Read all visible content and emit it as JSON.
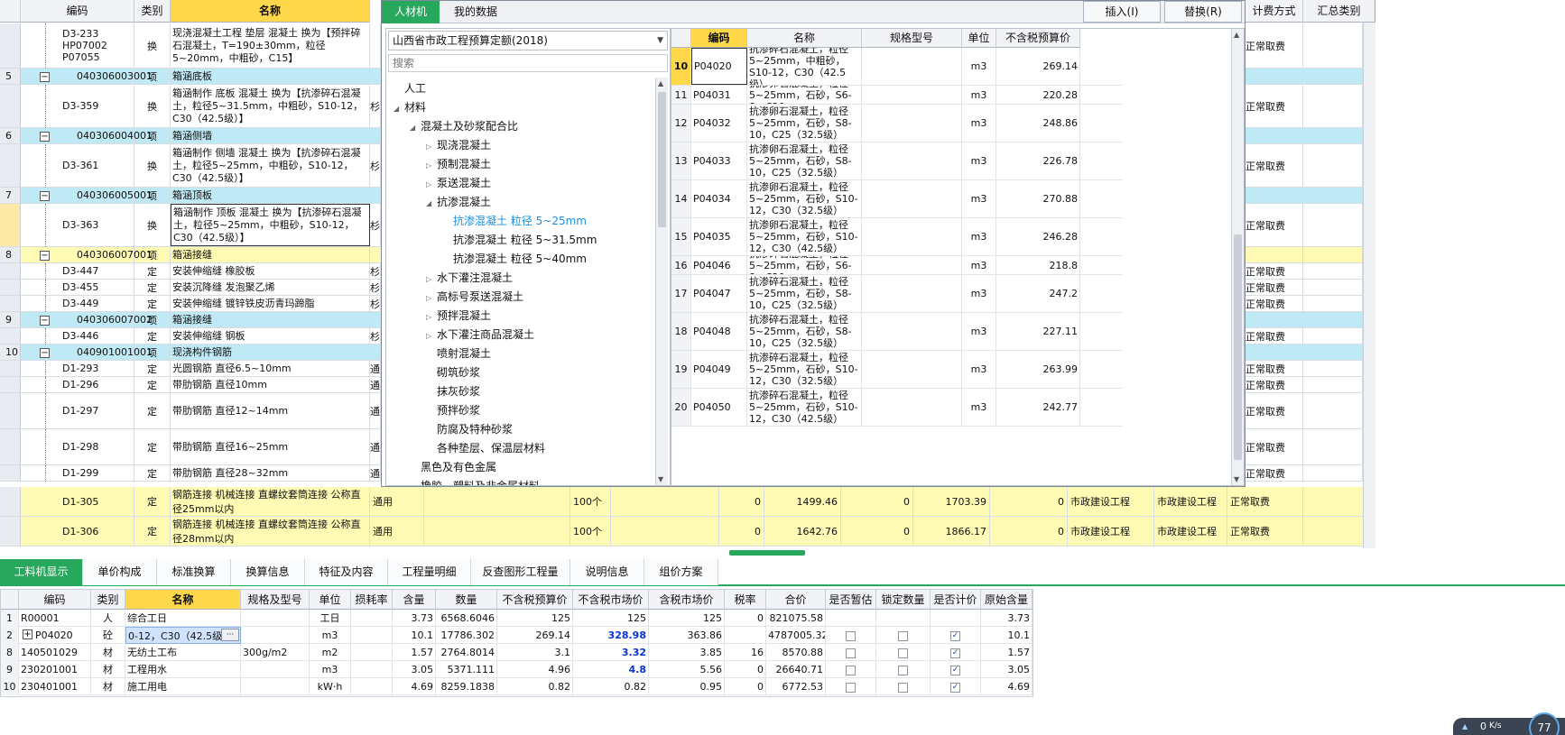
{
  "main_grid": {
    "headers": [
      "编码",
      "类别",
      "名称",
      "计费方式",
      "汇总类别"
    ],
    "rows": [
      {
        "num": "",
        "code": "D3-233\nHP07002\nP07055",
        "type": "换",
        "name": "现浇混凝土工程 垫层 混凝土 换为【预拌碎石混凝土，T=190±30mm，粒径5~20mm，中粗砂，C15】",
        "fee": "正常取费"
      },
      {
        "num": "5",
        "code": "040306003001",
        "type": "项",
        "name": "箱涵底板",
        "fee": ""
      },
      {
        "num": "",
        "code": "D3-359",
        "type": "换",
        "name": "箱涵制作 底板 混凝土 换为【抗渗碎石混凝土，粒径5~31.5mm，中粗砂，S10-12，C30（42.5级）】",
        "fee": "正常取费"
      },
      {
        "num": "6",
        "code": "040306004001",
        "type": "项",
        "name": "箱涵侧墙",
        "fee": ""
      },
      {
        "num": "",
        "code": "D3-361",
        "type": "换",
        "name": "箱涵制作 侧墙 混凝土 换为【抗渗碎石混凝土，粒径5~25mm，中粗砂，S10-12，C30（42.5级）】",
        "fee": "正常取费"
      },
      {
        "num": "7",
        "code": "040306005001",
        "type": "项",
        "name": "箱涵顶板",
        "fee": ""
      },
      {
        "num": "",
        "code": "D3-363",
        "type": "换",
        "name": "箱涵制作 顶板 混凝土 换为【抗渗碎石混凝土，粒径5~25mm，中粗砂，S10-12，C30（42.5级）】",
        "fee": "正常取费"
      },
      {
        "num": "8",
        "code": "040306007001",
        "type": "项",
        "name": "箱涵接缝",
        "fee": ""
      },
      {
        "num": "",
        "code": "D3-447",
        "type": "定",
        "name": "安装伸缩缝 橡胶板",
        "fee": "正常取费"
      },
      {
        "num": "",
        "code": "D3-455",
        "type": "定",
        "name": "安装沉降缝 发泡聚乙烯",
        "fee": "正常取费"
      },
      {
        "num": "",
        "code": "D3-449",
        "type": "定",
        "name": "安装伸缩缝 镀锌铁皮沥青玛蹄脂",
        "fee": "正常取费"
      },
      {
        "num": "9",
        "code": "040306007002",
        "type": "项",
        "name": "箱涵接缝",
        "fee": ""
      },
      {
        "num": "",
        "code": "D3-446",
        "type": "定",
        "name": "安装伸缩缝 钢板",
        "fee": "正常取费"
      },
      {
        "num": "10",
        "code": "040901001001",
        "type": "项",
        "name": "现浇构件钢筋",
        "fee": ""
      },
      {
        "num": "",
        "code": "D1-293",
        "type": "定",
        "name": "光圆钢筋 直径6.5~10mm",
        "fee": "正常取费"
      },
      {
        "num": "",
        "code": "D1-296",
        "type": "定",
        "name": "带肋钢筋 直径10mm",
        "fee": "正常取费"
      },
      {
        "num": "",
        "code": "D1-297",
        "type": "定",
        "name": "带肋钢筋 直径12~14mm",
        "fee": "正常取费"
      },
      {
        "num": "",
        "code": "D1-298",
        "type": "定",
        "name": "带肋钢筋 直径16~25mm",
        "fee": "正常取费"
      },
      {
        "num": "",
        "code": "D1-299",
        "type": "定",
        "name": "带肋钢筋 直径28~32mm",
        "fee": "正常取费"
      }
    ],
    "bottom_rows": [
      {
        "code": "D1-305",
        "type": "定",
        "name": "钢筋连接 机械连接 直螺纹套筒连接 公称直径25mm以内",
        "spec": "通用",
        "unit": "100个",
        "qty": "0",
        "price": "1499.46",
        "v2": "0",
        "v3": "1703.39",
        "v4": "0",
        "c1": "市政建设工程",
        "c2": "市政建设工程",
        "fee": "正常取费"
      },
      {
        "code": "D1-306",
        "type": "定",
        "name": "钢筋连接 机械连接 直螺纹套筒连接 公称直径28mm以内",
        "spec": "通用",
        "unit": "100个",
        "qty": "0",
        "price": "1642.76",
        "v2": "0",
        "v3": "1866.17",
        "v4": "0",
        "c1": "市政建设工程",
        "c2": "市政建设工程",
        "fee": "正常取费"
      }
    ],
    "col_prefix_mid": "杉",
    "col_prefix_end": "通"
  },
  "dialog": {
    "tabs": [
      "人材机",
      "我的数据"
    ],
    "buttons": [
      "插入(I)",
      "替换(R)"
    ],
    "quota_select": "山西省市政工程预算定额(2018)",
    "search_placeholder": "搜索",
    "tree": [
      {
        "label": "人工",
        "level": 0,
        "arrow": ""
      },
      {
        "label": "材料",
        "level": 0,
        "arrow": "open"
      },
      {
        "label": "混凝土及砂浆配合比",
        "level": 1,
        "arrow": "open"
      },
      {
        "label": "现浇混凝土",
        "level": 2,
        "arrow": "closed"
      },
      {
        "label": "预制混凝土",
        "level": 2,
        "arrow": "closed"
      },
      {
        "label": "泵送混凝土",
        "level": 2,
        "arrow": "closed"
      },
      {
        "label": "抗渗混凝土",
        "level": 2,
        "arrow": "open"
      },
      {
        "label": "抗渗混凝土 粒径 5~25mm",
        "level": 3,
        "arrow": "",
        "selected": true
      },
      {
        "label": "抗渗混凝土 粒径 5~31.5mm",
        "level": 3,
        "arrow": ""
      },
      {
        "label": "抗渗混凝土 粒径 5~40mm",
        "level": 3,
        "arrow": ""
      },
      {
        "label": "水下灌注混凝土",
        "level": 2,
        "arrow": "closed"
      },
      {
        "label": "高标号泵送混凝土",
        "level": 2,
        "arrow": "closed"
      },
      {
        "label": "预拌混凝土",
        "level": 2,
        "arrow": "closed"
      },
      {
        "label": "水下灌注商品混凝土",
        "level": 2,
        "arrow": "closed"
      },
      {
        "label": "喷射混凝土",
        "level": 2,
        "arrow": ""
      },
      {
        "label": "砌筑砂浆",
        "level": 2,
        "arrow": ""
      },
      {
        "label": "抹灰砂浆",
        "level": 2,
        "arrow": ""
      },
      {
        "label": "预拌砂浆",
        "level": 2,
        "arrow": ""
      },
      {
        "label": "防腐及特种砂浆",
        "level": 2,
        "arrow": ""
      },
      {
        "label": "各种垫层、保温层材料",
        "level": 2,
        "arrow": ""
      },
      {
        "label": "黑色及有色金属",
        "level": 1,
        "arrow": ""
      },
      {
        "label": "橡胶、塑料及非金属材料",
        "level": 1,
        "arrow": ""
      }
    ],
    "mat_headers": [
      "编码",
      "名称",
      "规格型号",
      "单位",
      "不含税预算价"
    ],
    "materials": [
      {
        "num": "10",
        "code": "P04020",
        "name": "抗渗碎石混凝土，粒径5~25mm，中粗砂，S10-12，C30（42.5级）",
        "unit": "m3",
        "price": "269.14"
      },
      {
        "num": "11",
        "code": "P04031",
        "name": "抗渗卵石混凝土，粒径5~25mm，石砂，S6-8，C20",
        "unit": "m3",
        "price": "220.28"
      },
      {
        "num": "12",
        "code": "P04032",
        "name": "抗渗卵石混凝土，粒径5~25mm，石砂，S8-10，C25（32.5级）",
        "unit": "m3",
        "price": "248.86"
      },
      {
        "num": "13",
        "code": "P04033",
        "name": "抗渗卵石混凝土，粒径5~25mm，石砂，S8-10，C25（32.5级）",
        "unit": "m3",
        "price": "226.78"
      },
      {
        "num": "14",
        "code": "P04034",
        "name": "抗渗卵石混凝土，粒径5~25mm，石砂，S10-12，C30（32.5级）",
        "unit": "m3",
        "price": "270.88"
      },
      {
        "num": "15",
        "code": "P04035",
        "name": "抗渗卵石混凝土，粒径5~25mm，石砂，S10-12，C30（42.5级）",
        "unit": "m3",
        "price": "246.28"
      },
      {
        "num": "16",
        "code": "P04046",
        "name": "抗渗碎石混凝土，粒径5~25mm，石砂，S6-8，C20",
        "unit": "m3",
        "price": "218.8"
      },
      {
        "num": "17",
        "code": "P04047",
        "name": "抗渗碎石混凝土，粒径5~25mm，石砂，S8-10，C25（32.5级）",
        "unit": "m3",
        "price": "247.2"
      },
      {
        "num": "18",
        "code": "P04048",
        "name": "抗渗碎石混凝土，粒径5~25mm，石砂，S8-10，C25（32.5级）",
        "unit": "m3",
        "price": "227.11"
      },
      {
        "num": "19",
        "code": "P04049",
        "name": "抗渗碎石混凝土，粒径5~25mm，石砂，S10-12，C30（32.5级）",
        "unit": "m3",
        "price": "263.99"
      },
      {
        "num": "20",
        "code": "P04050",
        "name": "抗渗碎石混凝土，粒径5~25mm，石砂，S10-12，C30（42.5级）",
        "unit": "m3",
        "price": "242.77"
      }
    ]
  },
  "bottom_tabs": [
    "工料机显示",
    "单价构成",
    "标准换算",
    "换算信息",
    "特征及内容",
    "工程量明细",
    "反查图形工程量",
    "说明信息",
    "组价方案"
  ],
  "bottom_grid": {
    "headers": [
      "编码",
      "类别",
      "名称",
      "规格及型号",
      "单位",
      "损耗率",
      "含量",
      "数量",
      "不含税预算价",
      "不含税市场价",
      "含税市场价",
      "税率",
      "合价",
      "是否暂估",
      "锁定数量",
      "是否计价",
      "原始含量"
    ],
    "rows": [
      {
        "num": "1",
        "code": "R00001",
        "type": "人",
        "name": "综合工日",
        "spec": "",
        "unit": "工日",
        "loss": "",
        "content": "3.73",
        "qty": "6568.6046",
        "budget": "125",
        "market": "125",
        "tax_market": "125",
        "rate": "0",
        "total": "821075.58",
        "est": false,
        "lock": false,
        "price": true,
        "orig": "3.73",
        "has_checkboxes": false
      },
      {
        "num": "2",
        "code": "P04020",
        "type": "砼",
        "name": "0-12，C30（42.5级）",
        "spec": "",
        "unit": "m3",
        "loss": "",
        "content": "10.1",
        "qty": "17786.302",
        "budget": "269.14",
        "market": "328.98",
        "tax_market": "363.86",
        "rate": "",
        "total": "4787005.32",
        "est": false,
        "lock": false,
        "price": true,
        "orig": "10.1",
        "has_checkboxes": true,
        "expand": "+"
      },
      {
        "num": "8",
        "code": "140501029",
        "type": "材",
        "name": "无纺土工布",
        "spec": "300g/m2",
        "unit": "m2",
        "loss": "",
        "content": "1.57",
        "qty": "2764.8014",
        "budget": "3.1",
        "market": "3.32",
        "tax_market": "3.85",
        "rate": "16",
        "total": "8570.88",
        "est": false,
        "lock": false,
        "price": true,
        "orig": "1.57",
        "has_checkboxes": true
      },
      {
        "num": "9",
        "code": "230201001",
        "type": "材",
        "name": "工程用水",
        "spec": "",
        "unit": "m3",
        "loss": "",
        "content": "3.05",
        "qty": "5371.111",
        "budget": "4.96",
        "market": "4.8",
        "tax_market": "5.56",
        "rate": "0",
        "total": "26640.71",
        "est": false,
        "lock": false,
        "price": true,
        "orig": "3.05",
        "has_checkboxes": true
      },
      {
        "num": "10",
        "code": "230401001",
        "type": "材",
        "name": "施工用电",
        "spec": "",
        "unit": "kW·h",
        "loss": "",
        "content": "4.69",
        "qty": "8259.1838",
        "budget": "0.82",
        "market": "0.82",
        "tax_market": "0.95",
        "rate": "0",
        "total": "6772.53",
        "est": false,
        "lock": false,
        "price": true,
        "orig": "4.69",
        "has_checkboxes": true
      }
    ]
  },
  "status": {
    "net_speed": "0",
    "net_unit": "K/s",
    "percent": "77"
  },
  "colors": {
    "accent": "#27a85c",
    "header_yellow": "#ffd74a",
    "row_blue": "#bfe9f5",
    "row_yellow": "#fffbb4",
    "price_blue": "#0a33d6"
  }
}
